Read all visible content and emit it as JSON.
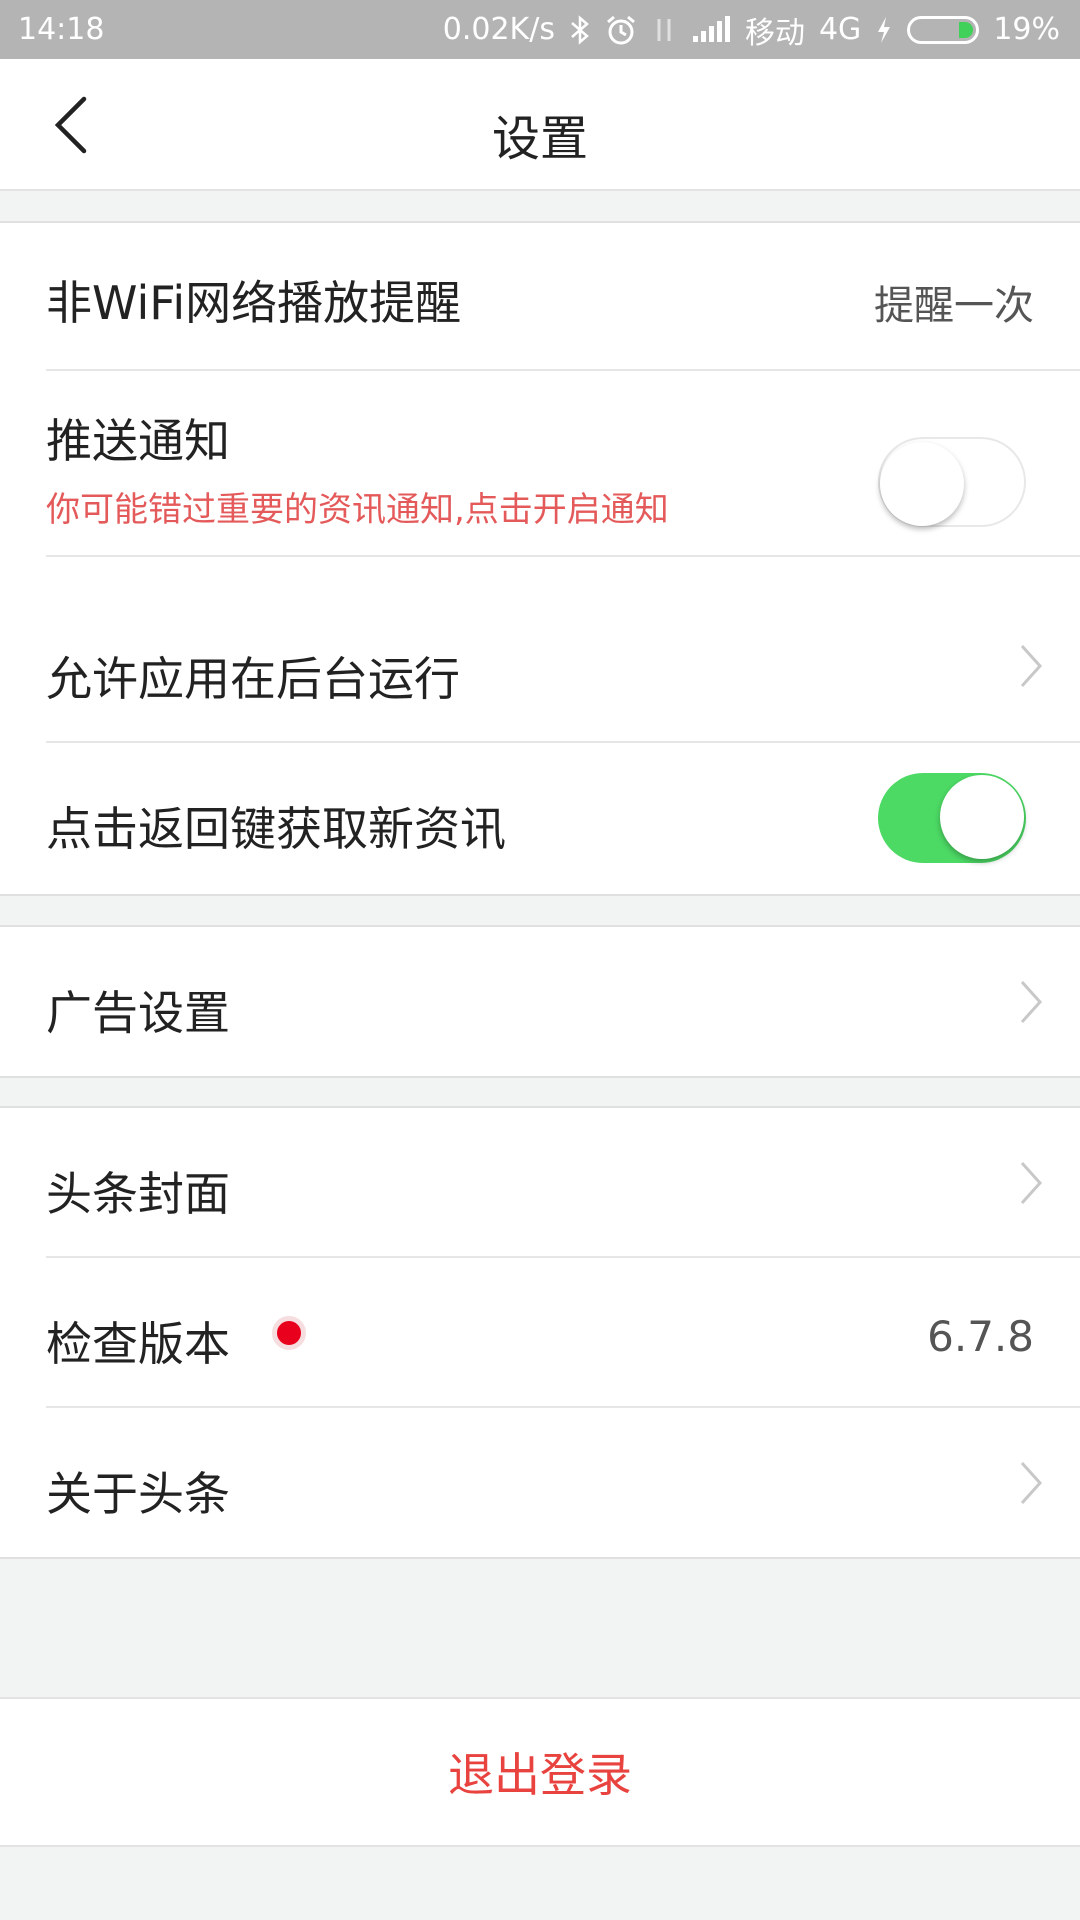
{
  "status_bar": {
    "time": "14:18",
    "speed": "0.02K/s",
    "carrier": "移动",
    "network": "4G",
    "battery": "19%",
    "icons": [
      "bluetooth-icon",
      "alarm-icon",
      "data-transfer-icon",
      "signal-icon",
      "charging-icon",
      "battery-icon"
    ]
  },
  "header": {
    "title": "设置"
  },
  "settings": {
    "nonwifi": {
      "label": "非WiFi网络播放提醒",
      "value": "提醒一次"
    },
    "push": {
      "label": "推送通知",
      "hint": "你可能错过重要的资讯通知,点击开启通知",
      "enabled": false
    },
    "background": {
      "label": "允许应用在后台运行"
    },
    "back_refresh": {
      "label": "点击返回键获取新资讯",
      "enabled": true
    },
    "ads": {
      "label": "广告设置"
    },
    "cover": {
      "label": "头条封面"
    },
    "version": {
      "label": "检查版本",
      "value": "6.7.8"
    },
    "about": {
      "label": "关于头条"
    }
  },
  "logout": {
    "label": "退出登录"
  },
  "colors": {
    "accent_red": "#e8433f",
    "toggle_on": "#4cd964",
    "statusbar_bg": "#b4b4b4"
  }
}
